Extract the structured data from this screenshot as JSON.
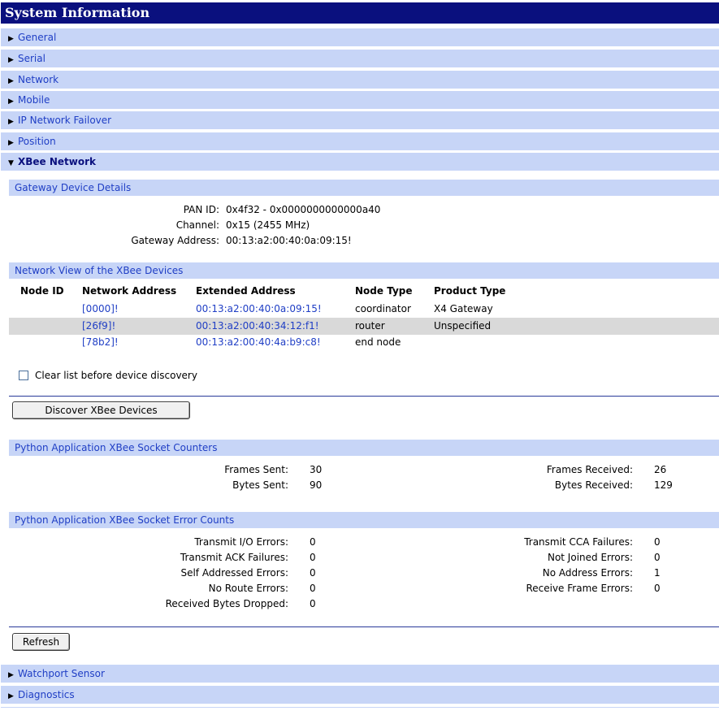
{
  "title": "System Information",
  "sections_top": [
    {
      "label": "General"
    },
    {
      "label": "Serial"
    },
    {
      "label": "Network"
    },
    {
      "label": "Mobile"
    },
    {
      "label": "IP Network Failover"
    },
    {
      "label": "Position"
    }
  ],
  "xbee": {
    "label": "XBee Network",
    "gateway": {
      "heading": "Gateway Device Details",
      "pan_label": "PAN ID:",
      "pan_value": "0x4f32 - 0x0000000000000a40",
      "channel_label": "Channel:",
      "channel_value": "0x15 (2455 MHz)",
      "address_label": "Gateway Address:",
      "address_value": "00:13:a2:00:40:0a:09:15!"
    },
    "network_view": {
      "heading": "Network View of the XBee Devices",
      "columns": [
        "Node ID",
        "Network Address",
        "Extended Address",
        "Node Type",
        "Product Type"
      ],
      "rows": [
        {
          "node_id": "",
          "network": "[0000]!",
          "extended": "00:13:a2:00:40:0a:09:15!",
          "type": "coordinator",
          "product": "X4 Gateway"
        },
        {
          "node_id": "",
          "network": "[26f9]!",
          "extended": "00:13:a2:00:40:34:12:f1!",
          "type": "router",
          "product": "Unspecified"
        },
        {
          "node_id": "",
          "network": "[78b2]!",
          "extended": "00:13:a2:00:40:4a:b9:c8!",
          "type": "end node",
          "product": ""
        }
      ]
    },
    "clear_label": "Clear list before device discovery",
    "discover_button": "Discover XBee Devices",
    "counters": {
      "heading": "Python Application XBee Socket Counters",
      "frames_sent_label": "Frames Sent:",
      "frames_sent": "30",
      "bytes_sent_label": "Bytes Sent:",
      "bytes_sent": "90",
      "frames_received_label": "Frames Received:",
      "frames_received": "26",
      "bytes_received_label": "Bytes Received:",
      "bytes_received": "129"
    },
    "errors": {
      "heading": "Python Application XBee Socket Error Counts",
      "left": [
        {
          "label": "Transmit I/O Errors:",
          "value": "0"
        },
        {
          "label": "Transmit ACK Failures:",
          "value": "0"
        },
        {
          "label": "Self Addressed Errors:",
          "value": "0"
        },
        {
          "label": "No Route Errors:",
          "value": "0"
        },
        {
          "label": "Received Bytes Dropped:",
          "value": "0"
        }
      ],
      "right": [
        {
          "label": "Transmit CCA Failures:",
          "value": "0"
        },
        {
          "label": "Not Joined Errors:",
          "value": "0"
        },
        {
          "label": "No Address Errors:",
          "value": "1"
        },
        {
          "label": "Receive Frame Errors:",
          "value": "0"
        }
      ]
    },
    "refresh_button": "Refresh"
  },
  "sections_bottom": [
    {
      "label": "Watchport Sensor"
    },
    {
      "label": "Diagnostics"
    }
  ],
  "colors": {
    "titlebar": "#0a107e",
    "section_bg": "#c7d5f7",
    "link": "#1f3ec5"
  }
}
